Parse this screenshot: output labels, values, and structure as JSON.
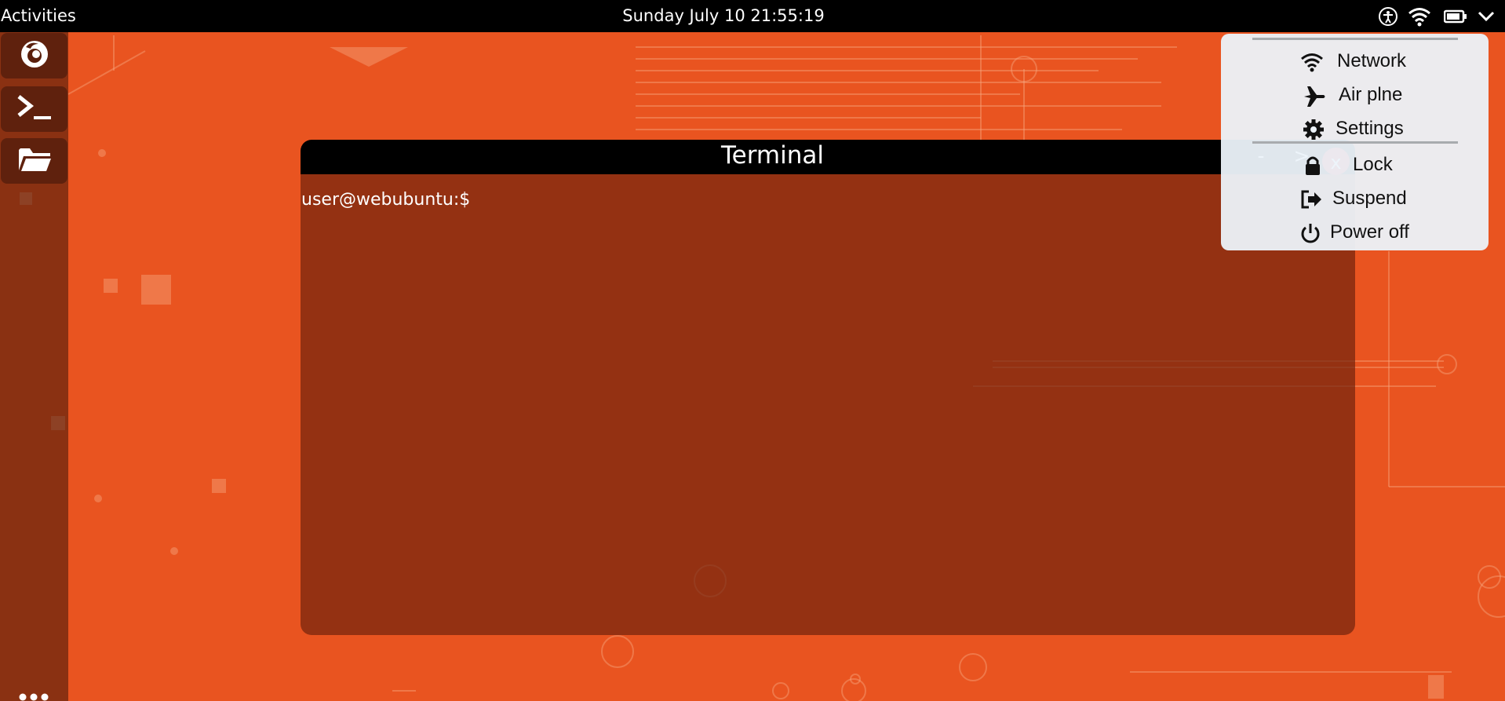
{
  "topbar": {
    "activities_label": "Activities",
    "clock": "Sunday July 10 21:55:19",
    "tray_icons": [
      "accessibility-icon",
      "wifi-icon",
      "battery-icon",
      "chevron-down-icon"
    ]
  },
  "dock": {
    "apps": [
      {
        "name": "Firefox",
        "icon": "firefox-icon"
      },
      {
        "name": "Terminal",
        "icon": "terminal-icon"
      },
      {
        "name": "Files",
        "icon": "folder-icon"
      }
    ],
    "show_apps_icon": "apps-grid-icon"
  },
  "terminal": {
    "title": "Terminal",
    "minimize_label": "-",
    "maximize_label": ">",
    "close_label": "x",
    "prompt": "user@webubuntu:$"
  },
  "system_menu": {
    "items": [
      {
        "label": "Network",
        "icon": "wifi-icon"
      },
      {
        "label": "Air plne",
        "icon": "airplane-icon"
      },
      {
        "label": "Settings",
        "icon": "gear-icon"
      },
      {
        "label": "Lock",
        "icon": "lock-icon"
      },
      {
        "label": "Suspend",
        "icon": "suspend-icon"
      },
      {
        "label": "Power off",
        "icon": "power-icon"
      }
    ]
  },
  "colors": {
    "desktop": "#e95420",
    "topbar": "#000000",
    "close_button": "#e0141e",
    "menu_background": "#ecf3fa"
  }
}
